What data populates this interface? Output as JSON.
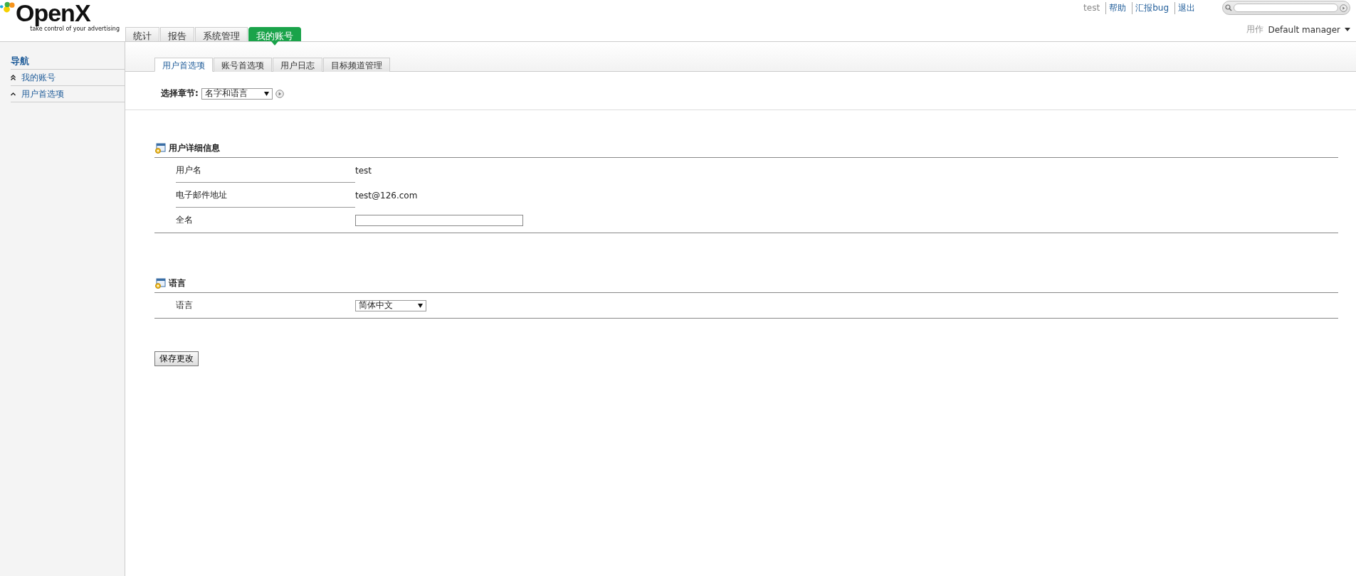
{
  "logo": {
    "name": "OpenX",
    "tagline": "take control of your advertising"
  },
  "top_links": [
    {
      "label": "test",
      "kind": "user"
    },
    {
      "label": "帮助",
      "kind": "link"
    },
    {
      "label": "汇报bug",
      "kind": "link"
    },
    {
      "label": "退出",
      "kind": "link"
    }
  ],
  "account": {
    "label": "用作",
    "value": "Default manager"
  },
  "main_tabs": [
    {
      "label": "统计",
      "selected": false
    },
    {
      "label": "报告",
      "selected": false
    },
    {
      "label": "系统管理",
      "selected": false
    },
    {
      "label": "我的账号",
      "selected": true
    }
  ],
  "sidebar": {
    "title": "导航",
    "items": [
      {
        "label": "我的账号",
        "kind": "parent"
      },
      {
        "label": "用户首选项",
        "kind": "current"
      }
    ]
  },
  "sub_tabs": [
    {
      "label": "用户首选项",
      "selected": true
    },
    {
      "label": "账号首选项",
      "selected": false
    },
    {
      "label": "用户日志",
      "selected": false
    },
    {
      "label": "目标频道管理",
      "selected": false
    }
  ],
  "section_select": {
    "label": "选择章节:",
    "value": "名字和语言"
  },
  "sections": [
    {
      "title": "用户详细信息",
      "rows": [
        {
          "label": "用户名",
          "kind": "text",
          "value": "test"
        },
        {
          "label": "电子邮件地址",
          "kind": "text",
          "value": "test@126.com"
        },
        {
          "label": "全名",
          "kind": "input"
        }
      ]
    },
    {
      "title": "语言",
      "rows": [
        {
          "label": "语言",
          "kind": "select",
          "value": "简体中文"
        }
      ]
    }
  ],
  "save_button": "保存更改"
}
